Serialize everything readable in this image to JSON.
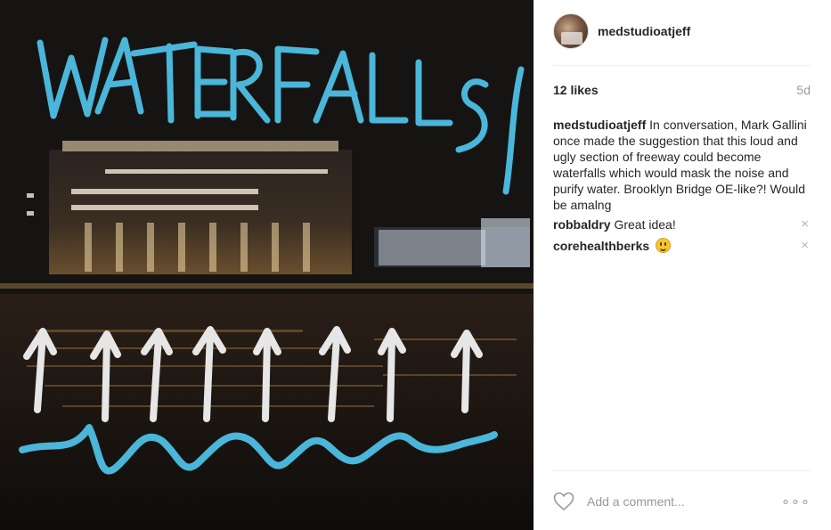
{
  "photo": {
    "title_text": "WATERFALLS",
    "colors": {
      "scribble": "#4ab6d9",
      "arrows": "#e6e6e6",
      "sky": "#151313"
    }
  },
  "post": {
    "username": "medstudioatjeff",
    "likes": "12 likes",
    "age": "5d",
    "caption": {
      "user": "medstudioatjeff",
      "text": "In conversation, Mark Gallini once made the suggestion that this loud and ugly section of freeway could become waterfalls which would mask the noise and purify water. Brooklyn Bridge OE-like?! Would be amalng"
    },
    "comments": [
      {
        "user": "robbaldry",
        "text": "Great idea!",
        "remove_icon": "×"
      },
      {
        "user": "corehealthberks",
        "text": "",
        "emoji": "smiley-emoji",
        "remove_icon": "×"
      }
    ],
    "add_comment_placeholder": "Add a comment...",
    "more_icon": "∘∘∘"
  }
}
